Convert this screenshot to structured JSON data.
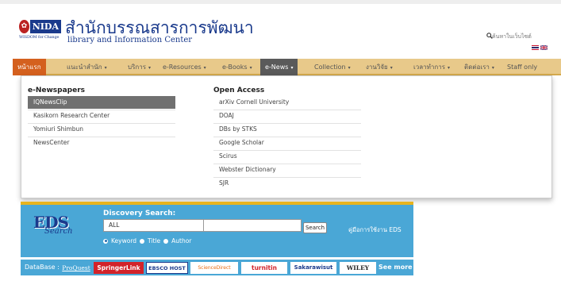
{
  "header": {
    "logo_text": "NIDA",
    "logo_sub": "WISDOM for Change",
    "title_th": "สำนักบรรณสารการพัฒนา",
    "title_en": "library and Information Center",
    "search_placeholder": "ค้นหาในเว็บไซต์"
  },
  "nav": {
    "items": [
      {
        "label": "หน้าแรก",
        "caret": ""
      },
      {
        "label": "แนะนำสำนัก",
        "caret": "▾"
      },
      {
        "label": "บริการ",
        "caret": "▾"
      },
      {
        "label": "e-Resources",
        "caret": "▾"
      },
      {
        "label": "e-Books",
        "caret": "▾"
      },
      {
        "label": "e-News",
        "caret": "▾"
      },
      {
        "label": "Collection",
        "caret": "▾"
      },
      {
        "label": "งานวิจัย",
        "caret": "▾"
      },
      {
        "label": "เวลาทำการ",
        "caret": "▾"
      },
      {
        "label": "ติดต่อเรา",
        "caret": "▾"
      },
      {
        "label": "Staff only",
        "caret": ""
      }
    ]
  },
  "dropdown": {
    "col1_title": "e-Newspapers",
    "col1_items": [
      "IQNewsClip",
      "Kasikorn Research Center",
      "Yomiuri Shimbun",
      "NewsCenter"
    ],
    "col2_title": "Open Access",
    "col2_items": [
      "arXiv Cornell University",
      "DOAJ",
      "DBs by STKS",
      "Google Scholar",
      "Scirus",
      "Webster Dictionary",
      "SJR"
    ]
  },
  "eds": {
    "logo_big": "EDS",
    "logo_script": "Search",
    "label": "Discovery Search:",
    "select_value": "ALL",
    "search_button": "Search",
    "help_link": "คู่มือการใช้งาน EDS",
    "radios": [
      "Keyword",
      "Title",
      "Author"
    ]
  },
  "databases": {
    "label": "DataBase :",
    "tiles": [
      "ProQuest",
      "SpringerLink",
      "EBSCO HOST",
      "ScienceDirect",
      "turnitin",
      "Sakarawisut",
      "WILEY"
    ],
    "see_more": "See more"
  },
  "colors": {
    "nav_bg": "#e8c98a",
    "home_bg": "#d4601e",
    "active_bg": "#5a5a5a",
    "eds_bg": "#4aa7d6",
    "brand_blue": "#1a3a8c"
  }
}
